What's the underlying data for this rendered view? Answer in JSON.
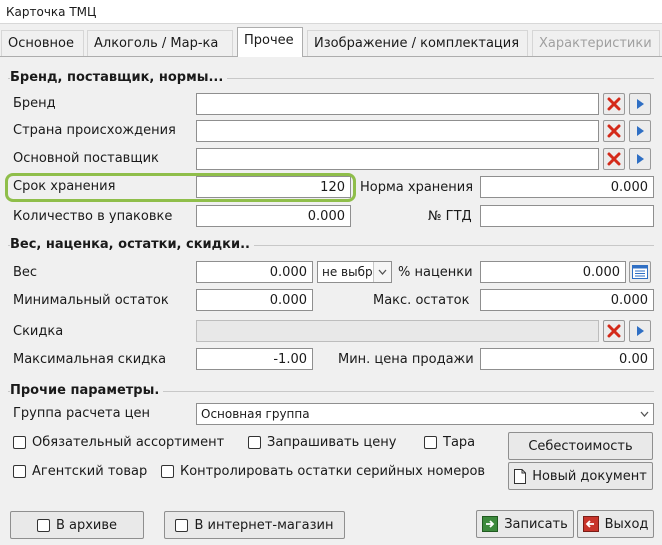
{
  "window": {
    "title": "Карточка ТМЦ"
  },
  "tabs": [
    {
      "label": "Основное"
    },
    {
      "label": "Алкоголь / Мар-ка"
    },
    {
      "label": "Прочее"
    },
    {
      "label": "Изображение / комплектация"
    },
    {
      "label": "Характеристики"
    }
  ],
  "sections": {
    "brand": "Бренд, поставщик, нормы...",
    "weight": "Вес, наценка, остатки, скидки..",
    "other": "Прочие параметры."
  },
  "brand_section": {
    "brand_label": "Бренд",
    "brand_value": "",
    "country_label": "Страна происхождения",
    "country_value": "",
    "supplier_label": "Основной поставщик",
    "supplier_value": "",
    "shelf_life_label": "Срок хранения",
    "shelf_life_value": "120",
    "storage_norm_label": "Норма хранения",
    "storage_norm_value": "0.000",
    "pack_qty_label": "Количество в упаковке",
    "pack_qty_value": "0.000",
    "gtd_label": "№ ГТД",
    "gtd_value": ""
  },
  "weight_section": {
    "weight_label": "Вес",
    "weight_value": "0.000",
    "unit_select_value": "не выбр",
    "markup_label": "% наценки",
    "markup_value": "0.000",
    "min_stock_label": "Минимальный остаток",
    "min_stock_value": "0.000",
    "max_stock_label": "Макс. остаток",
    "max_stock_value": "0.000",
    "discount_label": "Скидка",
    "discount_value": "",
    "max_discount_label": "Максимальная скидка",
    "max_discount_value": "-1.00",
    "min_price_label": "Мин. цена продажи",
    "min_price_value": "0.00"
  },
  "other_section": {
    "price_group_label": "Группа расчета цен",
    "price_group_value": "Основная группа",
    "mandatory_assortment": "Обязательный ассортимент",
    "ask_price": "Запрашивать цену",
    "tare": "Тара",
    "agent_goods": "Агентский товар",
    "control_serials": "Контролировать остатки серийных номеров",
    "cost_button": "Себестоимость",
    "new_doc_button": "Новый документ"
  },
  "footer": {
    "archive": "В архиве",
    "online_store": "В интернет-магазин",
    "save": "Записать",
    "exit": "Выход"
  },
  "colors": {
    "highlight": "#8fbe4a",
    "clear_red": "#d42a1a",
    "nav_blue": "#2f6fc4"
  },
  "icons": {
    "clear": "red-x-icon",
    "select": "blue-arrow-icon",
    "calc": "calculator-icon",
    "save": "save-icon",
    "exit": "exit-icon",
    "document": "document-icon"
  }
}
